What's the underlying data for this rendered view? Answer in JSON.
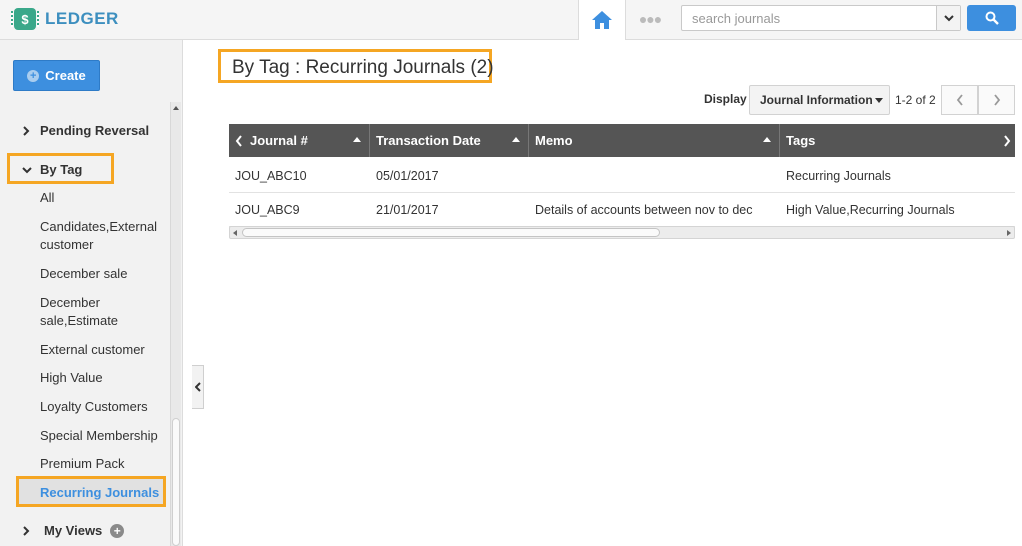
{
  "app": {
    "title": "LEDGER",
    "brand_color": "#3d8fbf"
  },
  "search": {
    "placeholder": "search journals"
  },
  "sidebar": {
    "create_label": "Create",
    "pending_reversal": "Pending Reversal",
    "by_tag": "By Tag",
    "tags": [
      "All",
      "Candidates,External customer",
      "December sale",
      "December sale,Estimate",
      "External customer",
      "High Value",
      "Loyalty Customers",
      "Special Membership",
      "Premium Pack",
      "Recurring Journals"
    ],
    "active_tag": "Recurring Journals",
    "my_views": "My Views"
  },
  "main": {
    "title": "By Tag : Recurring Journals (2)",
    "display_label": "Display",
    "display_value": "Journal Information",
    "pager": "1-2 of 2"
  },
  "table": {
    "columns": [
      "Journal #",
      "Transaction Date",
      "Memo",
      "Tags"
    ],
    "rows": [
      [
        "JOU_ABC10",
        "05/01/2017",
        "",
        "Recurring Journals"
      ],
      [
        "JOU_ABC9",
        "21/01/2017",
        "Details of accounts between nov to dec",
        "High Value,Recurring Journals"
      ]
    ]
  },
  "colors": {
    "accent": "#3d8fdf",
    "highlight": "#f5a623",
    "header_bg": "#555555"
  }
}
